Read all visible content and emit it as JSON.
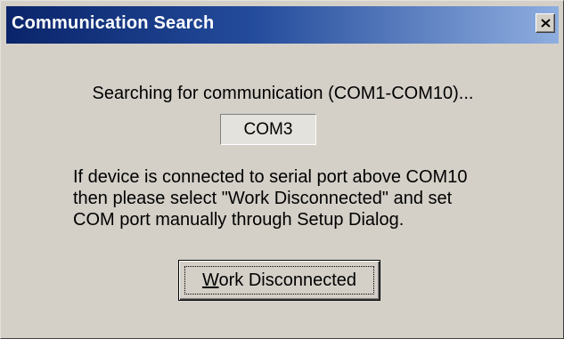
{
  "window": {
    "title": "Communication Search"
  },
  "content": {
    "searching_message": "Searching for communication (COM1-COM10)...",
    "current_port": "COM3",
    "info_lines": [
      "If device is connected to serial port above COM10",
      "then please select \"Work Disconnected\" and set",
      "COM port manually through Setup Dialog."
    ]
  },
  "buttons": {
    "work_disconnected": {
      "mnemonic": "W",
      "rest": "ork Disconnected"
    },
    "close_icon": "close-icon"
  },
  "colors": {
    "titlebar_start": "#0a246a",
    "titlebar_end": "#8faee0",
    "face": "#d4d0c8"
  }
}
